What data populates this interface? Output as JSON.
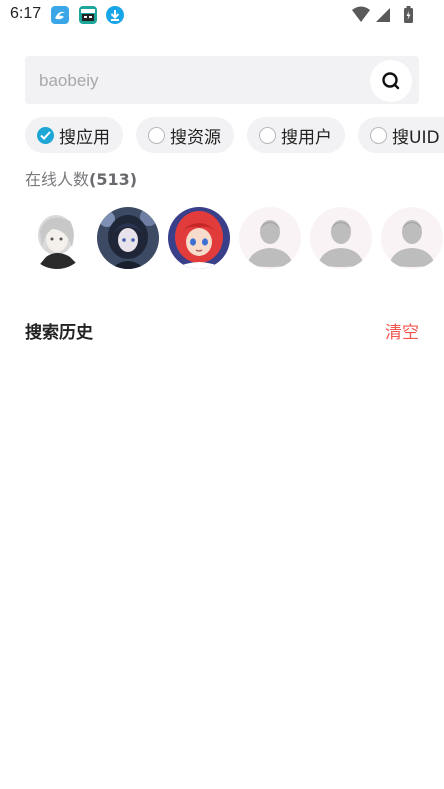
{
  "status_bar": {
    "time": "6:17",
    "notification_icons": [
      "app-notification-icon",
      "media-notification-icon",
      "download-icon"
    ],
    "system_icons": [
      "wifi-icon",
      "cell-signal-icon",
      "battery-icon"
    ]
  },
  "search": {
    "placeholder": "baobeiy",
    "value": "",
    "button_icon": "search-icon"
  },
  "filters": [
    {
      "label": "搜应用",
      "checked": true
    },
    {
      "label": "搜资源",
      "checked": false
    },
    {
      "label": "搜用户",
      "checked": false
    },
    {
      "label": "搜UID",
      "checked": false
    }
  ],
  "online": {
    "label": "在线人数",
    "count": "(513)"
  },
  "avatars": [
    {
      "type": "photo",
      "icon": "user-avatar-1"
    },
    {
      "type": "photo",
      "icon": "user-avatar-2"
    },
    {
      "type": "photo",
      "icon": "user-avatar-3"
    },
    {
      "type": "default",
      "icon": "default-avatar-icon"
    },
    {
      "type": "default",
      "icon": "default-avatar-icon"
    },
    {
      "type": "default",
      "icon": "default-avatar-icon"
    }
  ],
  "history": {
    "title": "搜索历史",
    "clear_label": "清空"
  },
  "colors": {
    "accent": "#1ea7d6",
    "clear": "#f0574e",
    "chip_bg": "#f2f2f4"
  }
}
